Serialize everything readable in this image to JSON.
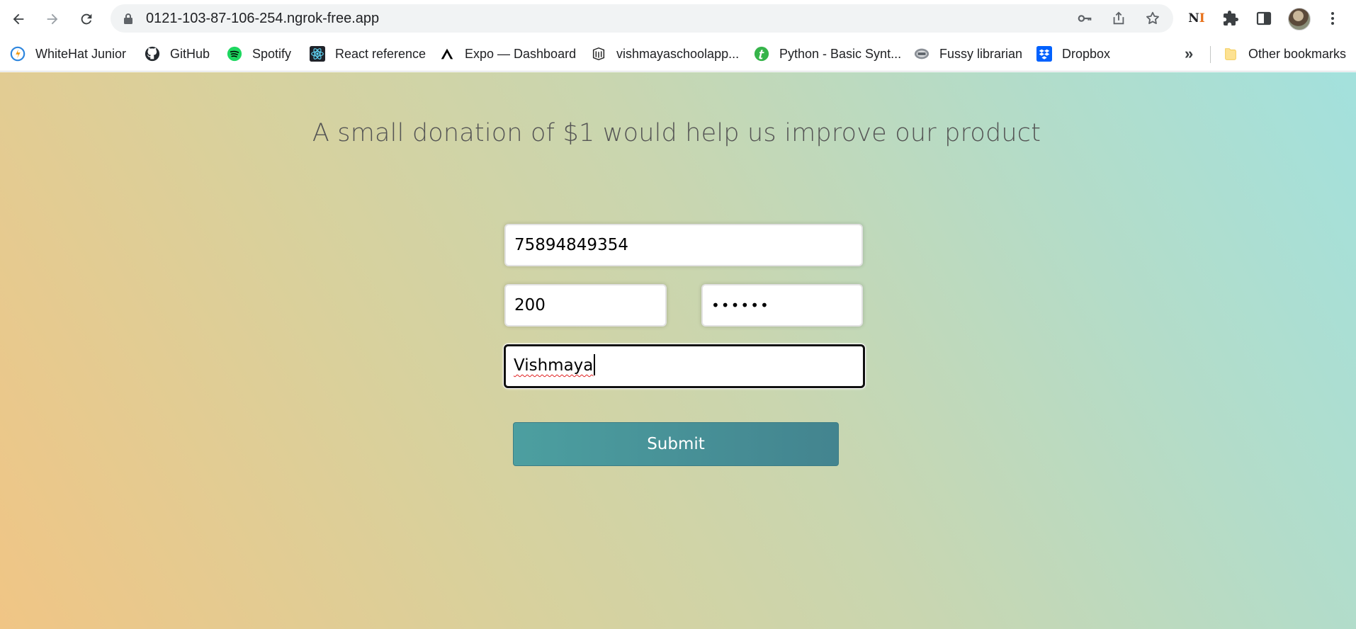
{
  "browser": {
    "url": "0121-103-87-106-254.ngrok-free.app",
    "extension_badge": "N",
    "extension_badge_suffix": "I",
    "bookmarks": [
      {
        "label": "WhiteHat Junior",
        "icon": "whitehat-icon"
      },
      {
        "label": "GitHub",
        "icon": "github-icon"
      },
      {
        "label": "Spotify",
        "icon": "spotify-icon"
      },
      {
        "label": "React reference",
        "icon": "react-icon"
      },
      {
        "label": "Expo — Dashboard",
        "icon": "expo-icon"
      },
      {
        "label": "vishmayaschoolapp...",
        "icon": "app-icon"
      },
      {
        "label": "Python - Basic Synt...",
        "icon": "tutorialspoint-icon"
      },
      {
        "label": "Fussy librarian",
        "icon": "fussy-librarian-icon"
      },
      {
        "label": "Dropbox",
        "icon": "dropbox-icon"
      }
    ],
    "more_label": "»",
    "other_bookmarks": "Other bookmarks"
  },
  "page": {
    "headline": "A small donation of $1 would help us improve our product",
    "form": {
      "card_number": "75894849354",
      "amount": "200",
      "pin_masked": "••••••",
      "name": "Vishmaya",
      "submit_label": "Submit"
    }
  },
  "colors": {
    "submit": "#43848f",
    "gradient_start": "#f0c585",
    "gradient_end": "#a3e1dd"
  }
}
